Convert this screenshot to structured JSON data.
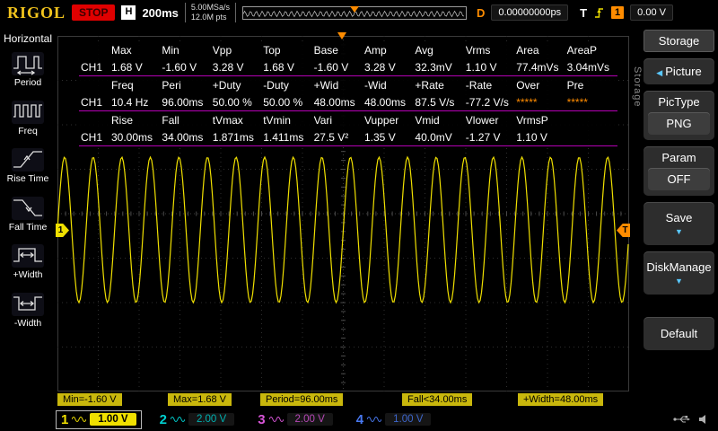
{
  "topbar": {
    "logo": "RIGOL",
    "run_state": "STOP",
    "h_label": "H",
    "timebase": "200ms",
    "sample_rate": "5.00MSa/s",
    "memory_depth": "12.0M pts",
    "delay_label": "D",
    "delay_value": "0.00000000ps",
    "trigger_label": "T",
    "trigger_source": "1",
    "trigger_level": "0.00 V"
  },
  "icons": {
    "submenu_left": "◀",
    "dropdown_down": "▼"
  },
  "left_menu": {
    "title": "Horizontal",
    "items": [
      {
        "label": "Period"
      },
      {
        "label": "Freq"
      },
      {
        "label": "Rise Time"
      },
      {
        "label": "Fall Time"
      },
      {
        "label": "+Width"
      },
      {
        "label": "-Width"
      }
    ]
  },
  "measurements": {
    "groups": [
      {
        "channel": "CH1",
        "headers": [
          "Max",
          "Min",
          "Vpp",
          "Top",
          "Base",
          "Amp",
          "Avg",
          "Vrms",
          "Area",
          "AreaP"
        ],
        "values": [
          "1.68 V",
          "-1.60 V",
          "3.28 V",
          "1.68 V",
          "-1.60 V",
          "3.28 V",
          "32.3mV",
          "1.10 V",
          "77.4mVs",
          "3.04mVs"
        ]
      },
      {
        "channel": "CH1",
        "headers": [
          "Freq",
          "Peri",
          "+Duty",
          "-Duty",
          "+Wid",
          "-Wid",
          "+Rate",
          "-Rate",
          "Over",
          "Pre"
        ],
        "values": [
          "10.4 Hz",
          "96.00ms",
          "50.00 %",
          "50.00 %",
          "48.00ms",
          "48.00ms",
          "87.5 V/s",
          "-77.2 V/s",
          "*****",
          "*****"
        ]
      },
      {
        "channel": "CH1",
        "headers": [
          "Rise",
          "Fall",
          "tVmax",
          "tVmin",
          "Vari",
          "Vupper",
          "Vmid",
          "Vlower",
          "VrmsP",
          ""
        ],
        "values": [
          "30.00ms",
          "34.00ms",
          "1.871ms",
          "1.411ms",
          "27.5 V²",
          "1.35 V",
          "40.0mV",
          "-1.27 V",
          "1.10 V",
          ""
        ]
      }
    ]
  },
  "measure_chips": [
    "Min=-1.60 V",
    "Max=1.68 V",
    "Period=96.00ms",
    "Fall<34.00ms",
    "+Width=48.00ms"
  ],
  "right_menu": {
    "tab": "Storage",
    "side_label": "Storage",
    "picture_label": "Picture",
    "pictype_label": "PicType",
    "pictype_value": "PNG",
    "param_label": "Param",
    "param_value": "OFF",
    "save_label": "Save",
    "diskmanage_label": "DiskManage",
    "default_label": "Default"
  },
  "channel_bar": [
    {
      "number": "1",
      "scale": "1.00 V",
      "color": "#f0e000",
      "active": true
    },
    {
      "number": "2",
      "scale": "2.00 V",
      "color": "#00d0d0",
      "active": false
    },
    {
      "number": "3",
      "scale": "2.00 V",
      "color": "#d855d8",
      "active": false
    },
    {
      "number": "4",
      "scale": "1.00 V",
      "color": "#4878f0",
      "active": false
    }
  ],
  "waveform": {
    "cycles": 20,
    "color": "#f0e000",
    "amplitude_divs": 1.64
  },
  "colors": {
    "accent_orange": "#ff8c00",
    "separator_magenta": "#b400b4",
    "chip_yellow": "#c9b70c"
  }
}
